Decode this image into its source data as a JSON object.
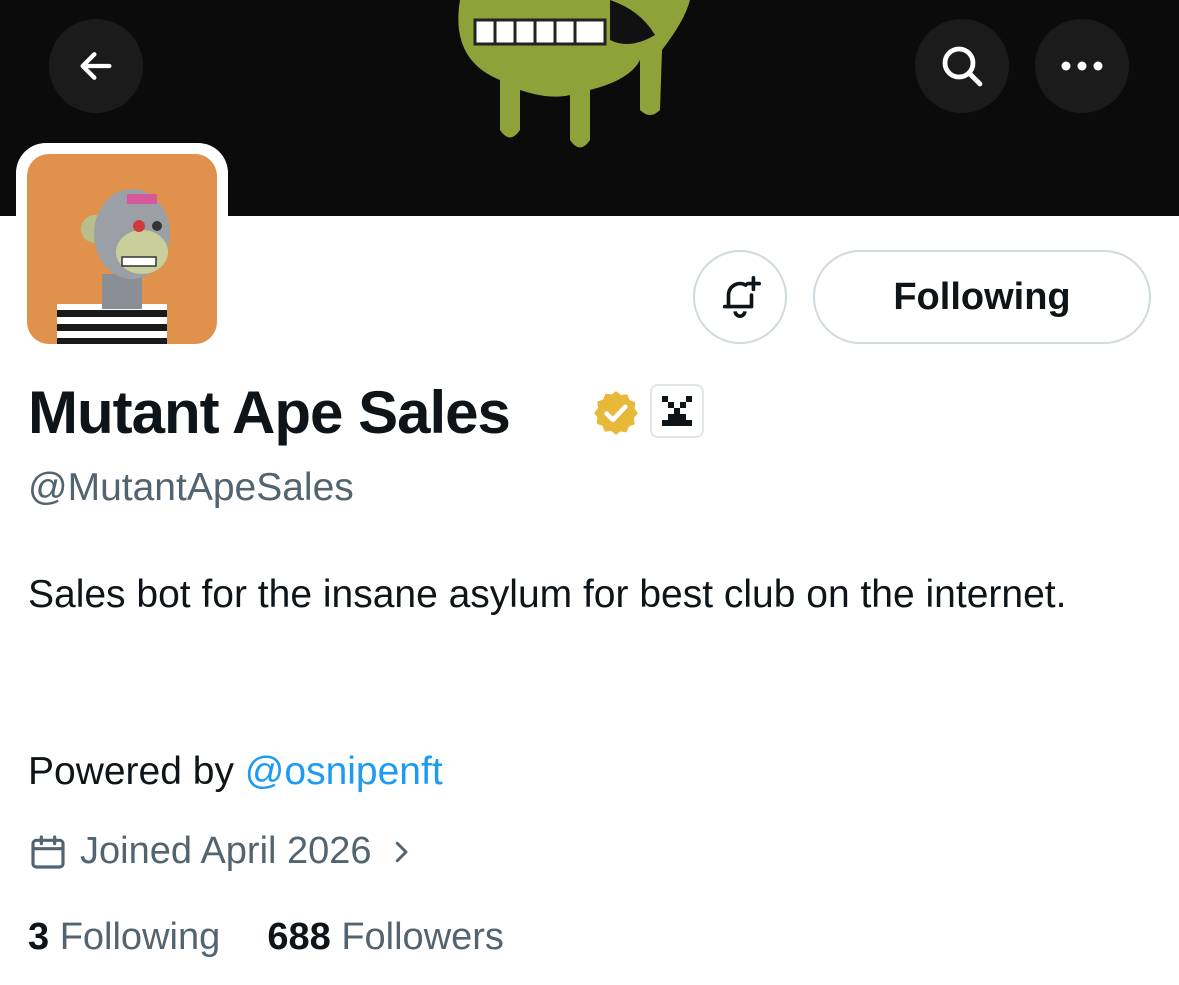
{
  "header": {
    "back_icon": "arrow-left-icon",
    "search_icon": "search-icon",
    "more_icon": "more-horizontal-icon"
  },
  "profile": {
    "display_name": "Mutant Ape Sales",
    "handle": "@MutantApeSales",
    "verified_badge": "gold-verified-icon",
    "affiliate_badge": "affiliate-logo-icon",
    "bio_line": "Sales bot for the insane asylum for best club on the internet.",
    "powered_prefix": "Powered by ",
    "powered_link": "@osnipenft",
    "joined": "Joined April 2026",
    "following_count": "3",
    "following_label": "Following",
    "followers_count": "688",
    "followers_label": "Followers"
  },
  "actions": {
    "notify_icon": "bell-plus-icon",
    "follow_state_label": "Following"
  },
  "colors": {
    "banner_bg": "#0b0b0b",
    "banner_art": "#8fa23a",
    "avatar_bg": "#e0924c",
    "link": "#1d9bf0",
    "muted": "#536471",
    "verified_gold": "#e8b83a"
  }
}
